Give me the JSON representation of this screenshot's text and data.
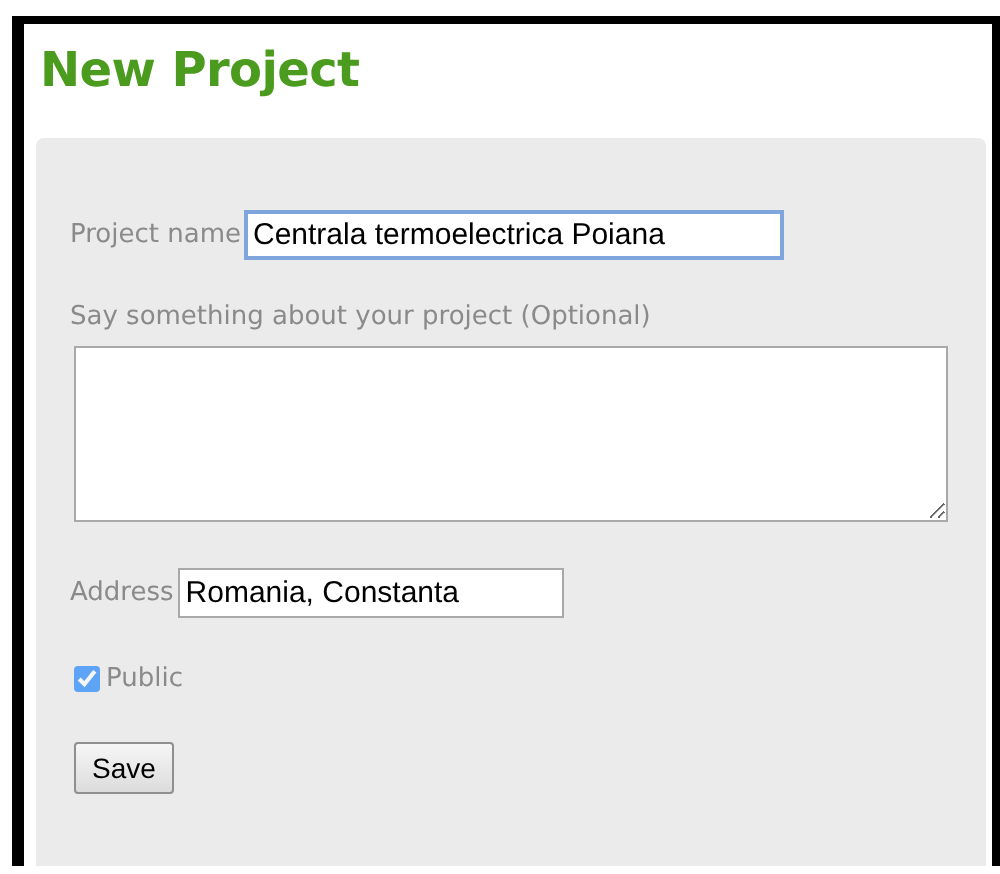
{
  "title": "New Project",
  "form": {
    "project_name": {
      "label": "Project name",
      "value": "Centrala termoelectrica Poiana",
      "focused": true
    },
    "description": {
      "label": "Say something about your project (Optional)"
    },
    "address": {
      "label": "Address",
      "value": "Romania, Constanta",
      "focused": false
    },
    "public": {
      "label": "Public",
      "checked": true
    },
    "save_button": "Save"
  }
}
